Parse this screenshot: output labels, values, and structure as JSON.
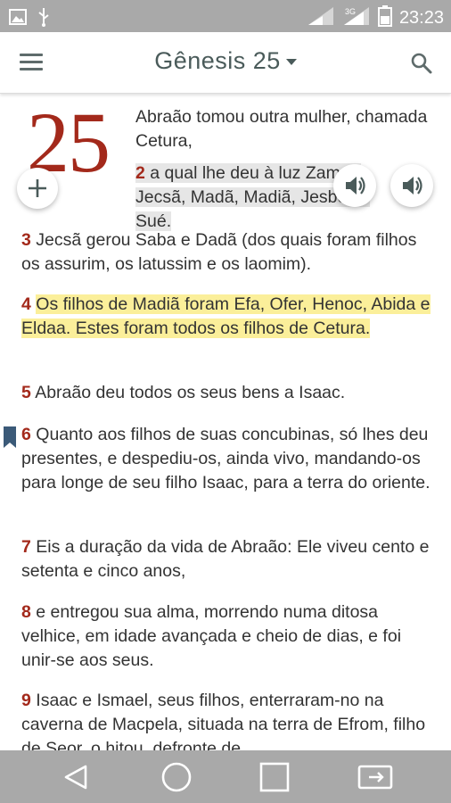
{
  "status_bar": {
    "time": "23:23",
    "icons": [
      "image-icon",
      "usb-icon",
      "signal-wifi-icon",
      "signal-3g-icon",
      "battery-icon"
    ]
  },
  "app_bar": {
    "title": "Gênesis 25",
    "menu_icon": "menu-icon",
    "search_icon": "search-icon"
  },
  "chapter": {
    "number": "25",
    "verses": [
      {
        "num": "",
        "text": "Abraão tomou outra mulher, chamada Cetura,"
      },
      {
        "num": "2",
        "text": "a qual lhe deu à luz Zamrã, Jecsã, Madã, Madiã, Jesboc e Sué."
      },
      {
        "num": "3",
        "text": "Jecsã gerou Saba e Dadã (dos quais foram filhos os assurim, os latussim e os laomim)."
      },
      {
        "num": "4",
        "text": "Os filhos de Madiã foram Efa, Ofer, Henoc, Abida e Eldaa. Estes foram todos os filhos de Cetura."
      },
      {
        "num": "5",
        "text": "Abraão deu todos os seus bens a Isaac."
      },
      {
        "num": "6",
        "text": "Quanto aos filhos de suas concubinas, só lhes deu presentes, e despediu-os, ainda vivo, mandando-os para longe de seu filho Isaac, para a terra do oriente."
      },
      {
        "num": "7",
        "text": "Eis a duração da vida de Abraão: Ele viveu cento e setenta e cinco anos,"
      },
      {
        "num": "8",
        "text": "e entregou sua alma, morrendo numa ditosa velhice, em idade avançada e cheio de dias, e foi unir-se aos seus."
      },
      {
        "num": "9",
        "text": "Isaac e Ismael, seus filhos, enterraram-no na caverna de Macpela, situada na terra de Efrom, filho de Seor, o hitou, defronte de"
      }
    ]
  },
  "floating": {
    "add_icon": "plus-icon",
    "audio_icon_1": "volume-icon",
    "audio_icon_2": "volume-icon"
  },
  "nav_bar": {
    "icons": [
      "back-icon",
      "home-icon",
      "recents-icon",
      "screen-cast-icon"
    ]
  },
  "colors": {
    "accent_red": "#a3291b",
    "highlight_yellow": "#fbef9a",
    "bar_gray": "#a9a9a9",
    "title_gray": "#4a5b5a"
  }
}
